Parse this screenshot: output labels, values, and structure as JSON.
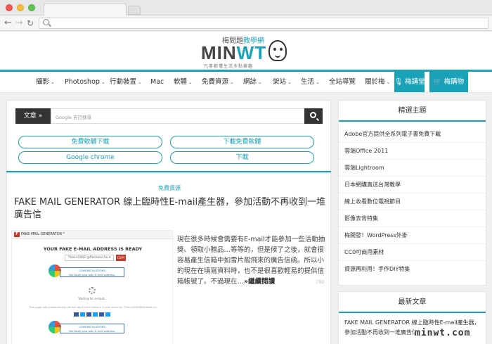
{
  "logo": {
    "top_left": "梅問題",
    "top_right": "教學網",
    "word_a": "MIN",
    "word_b": "WT",
    "subtitle": "凡事都懂生活多點樂趣"
  },
  "nav": {
    "items": [
      {
        "label": "攝影",
        "caret": true
      },
      {
        "label": "Photoshop",
        "caret": true
      },
      {
        "label": "行動裝置",
        "caret": true
      },
      {
        "label": "Mac",
        "caret": false
      },
      {
        "label": "軟體",
        "caret": true
      },
      {
        "label": "免費資源",
        "caret": true
      },
      {
        "label": "網誌",
        "caret": true
      },
      {
        "label": "架站",
        "caret": true
      },
      {
        "label": "生活",
        "caret": true
      },
      {
        "label": "全站導覽",
        "caret": false
      },
      {
        "label": "關於梅",
        "caret": true
      }
    ],
    "caret_glyph": "⌄",
    "buttons": [
      {
        "label": "梅講堂",
        "icon": "microphone-icon"
      },
      {
        "label": "梅購物",
        "icon": "basket-icon"
      }
    ]
  },
  "search": {
    "label": "文章",
    "label_arrow": "»",
    "placeholder_brand": "Google",
    "placeholder_text": "自訂搜尋"
  },
  "quick_links": [
    "免費軟體下載",
    "下載免費軟體",
    "Google chrome",
    "下載"
  ],
  "article": {
    "category": "免費資源",
    "title": "FAKE MAIL GENERATOR 線上臨時性E-mail產生器，參加活動不再收到一堆廣告信",
    "excerpt": "現在很多時候會需要有E-mail才能參加一些活動抽獎、領取小贈品…等等的，但是候了之後，就會很容易產生信箱中如雪片般飛來的廣告信函。所以小的現在在填寫資料時，也不是很喜歡輕易的提供信箱帳號了。不過現在…",
    "more": "»繼續閱讀",
    "date": "/30",
    "thumb": {
      "brand": "FAKE MAIL GENERATOR™",
      "brand_badge": "F",
      "headline": "YOUR FAKE E-MAIL ADDRESS IS READY",
      "email": "Theirs1942     @fleckens.hu ▾",
      "copy": "COPY",
      "congrats_title": "CONGRATULATIONS",
      "congrats_line": "You have your own E-mail address.",
      "waiting": "Waiting for e-mails...",
      "note": "This page will automatically refresh each time there is a new email for Theirs1942@fleckens.hu"
    }
  },
  "sidebar": {
    "featured_title": "精選主題",
    "featured": [
      "Adobe官方提供全系列電子書免費下載",
      "雲端Office 2011",
      "雲端Lightroom",
      "日本網購直送台灣教學",
      "線上收看數位電視節目",
      "影像去背特集",
      "梅開發！WordPress外掛",
      "CC0可商用素材",
      "資源再利用！手作DIY特集"
    ],
    "latest_title": "最新文章",
    "latest": [
      "FAKE MAIL GENERATOR 線上臨時性E-mail產生器，參加活動不再收到一堆廣告信"
    ]
  },
  "watermark": "minwt.com"
}
